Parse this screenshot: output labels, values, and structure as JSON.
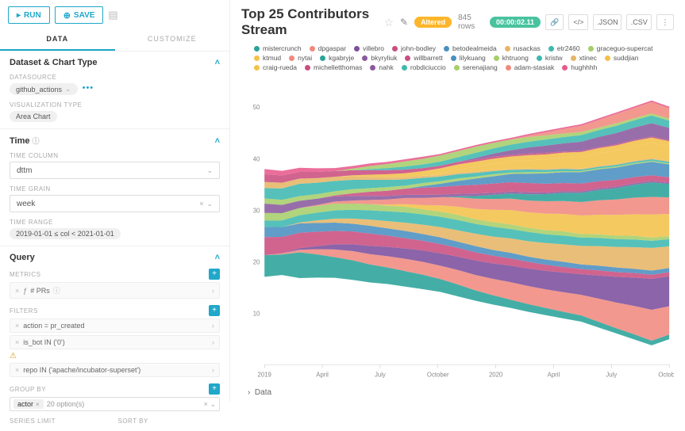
{
  "toolbar": {
    "run": "RUN",
    "save": "SAVE"
  },
  "tabs": {
    "data": "DATA",
    "customize": "CUSTOMIZE"
  },
  "panels": {
    "dataset": {
      "title": "Dataset & Chart Type",
      "datasource_label": "DATASOURCE",
      "datasource_value": "github_actions",
      "viz_label": "VISUALIZATION TYPE",
      "viz_value": "Area Chart"
    },
    "time": {
      "title": "Time",
      "col_label": "TIME COLUMN",
      "col_value": "dttm",
      "grain_label": "TIME GRAIN",
      "grain_value": "week",
      "range_label": "TIME RANGE",
      "range_value": "2019-01-01 ≤ col < 2021-01-01"
    },
    "query": {
      "title": "Query",
      "metrics_label": "METRICS",
      "metric_value": "# PRs",
      "filters_label": "FILTERS",
      "filters": [
        "action = pr_created",
        "is_bot IN ('0')",
        "repo IN ('apache/incubator-superset')"
      ],
      "groupby_label": "GROUP BY",
      "groupby_value": "actor",
      "groupby_options": "20 option(s)",
      "series_label": "SERIES LIMIT",
      "sort_label": "SORT BY"
    }
  },
  "header": {
    "title": "Top 25 Contributors Stream",
    "badge": "Altered",
    "rows": "845 rows",
    "timing": "00:00:02.11",
    "json": ".JSON",
    "csv": ".CSV"
  },
  "data_section": "Data",
  "chart_data": {
    "type": "area",
    "xlabel": "",
    "ylabel": "",
    "ylim": [
      0,
      55
    ],
    "x_ticks": [
      "2019",
      "April",
      "July",
      "October",
      "2020",
      "April",
      "July",
      "October"
    ],
    "y_ticks": [
      10,
      20,
      30,
      40,
      50
    ],
    "series": [
      {
        "name": "mistercrunch",
        "color": "#2aa39a",
        "values": [
          4.2,
          4.0,
          5.0,
          4.5,
          4.0,
          3.8,
          3.5,
          3.2,
          3.0,
          2.8,
          2.5,
          2.3,
          2.0,
          1.8,
          1.6,
          1.5,
          1.4,
          1.3,
          1.2,
          1.1,
          1.0,
          1.0,
          0.9,
          0.9
        ]
      },
      {
        "name": "dpgaspar",
        "color": "#f08a7e",
        "values": [
          0.0,
          0.2,
          0.5,
          1.0,
          1.5,
          1.8,
          2.0,
          2.2,
          2.4,
          2.5,
          2.6,
          2.8,
          3.0,
          3.2,
          3.4,
          3.5,
          3.6,
          3.8,
          4.0,
          4.5,
          5.0,
          5.5,
          6.0,
          5.5
        ]
      },
      {
        "name": "villebro",
        "color": "#7b4f9d",
        "values": [
          0.0,
          0.0,
          0.3,
          0.6,
          1.0,
          1.3,
          1.6,
          1.8,
          2.0,
          2.2,
          2.4,
          2.6,
          2.8,
          3.0,
          3.2,
          3.4,
          3.6,
          3.8,
          4.0,
          4.5,
          5.0,
          5.5,
          6.0,
          5.8
        ]
      },
      {
        "name": "john-bodley",
        "color": "#c94f80",
        "values": [
          3.5,
          3.2,
          3.0,
          2.8,
          2.6,
          2.5,
          2.4,
          2.2,
          2.0,
          1.9,
          1.8,
          1.7,
          1.6,
          1.5,
          1.4,
          1.3,
          1.2,
          1.1,
          1.0,
          1.0,
          0.9,
          0.9,
          0.8,
          0.8
        ]
      },
      {
        "name": "betodealmeida",
        "color": "#4a90c0",
        "values": [
          2.0,
          1.9,
          1.8,
          1.7,
          1.6,
          1.5,
          1.5,
          1.4,
          1.4,
          1.3,
          1.3,
          1.2,
          1.2,
          1.1,
          1.1,
          1.0,
          1.0,
          1.0,
          0.9,
          0.9,
          0.9,
          0.8,
          0.8,
          0.8
        ]
      },
      {
        "name": "rusackas",
        "color": "#e6b566",
        "values": [
          0.0,
          0.0,
          0.2,
          0.5,
          0.8,
          1.0,
          1.2,
          1.4,
          1.6,
          1.8,
          2.0,
          2.2,
          2.4,
          2.6,
          2.8,
          3.0,
          3.2,
          3.4,
          3.6,
          3.8,
          4.0,
          4.2,
          4.4,
          4.2
        ]
      },
      {
        "name": "etr2460",
        "color": "#3eb8b0",
        "values": [
          1.2,
          1.3,
          1.4,
          1.5,
          1.6,
          1.7,
          1.8,
          1.9,
          2.0,
          2.0,
          2.0,
          2.0,
          1.9,
          1.9,
          1.8,
          1.8,
          1.7,
          1.7,
          1.6,
          1.6,
          1.5,
          1.5,
          1.4,
          1.4
        ]
      },
      {
        "name": "graceguo-supercat",
        "color": "#a6ce6a",
        "values": [
          1.5,
          1.4,
          1.4,
          1.3,
          1.3,
          1.2,
          1.2,
          1.1,
          1.1,
          1.0,
          1.0,
          1.0,
          0.9,
          0.9,
          0.9,
          0.8,
          0.8,
          0.8,
          0.7,
          0.7,
          0.7,
          0.7,
          0.6,
          0.6
        ]
      },
      {
        "name": "ktmud",
        "color": "#f3c14a",
        "values": [
          0.0,
          0.0,
          0.0,
          0.0,
          0.0,
          0.0,
          0.0,
          0.2,
          0.5,
          0.8,
          1.2,
          1.6,
          2.0,
          2.4,
          2.8,
          3.0,
          3.2,
          3.4,
          3.6,
          3.8,
          4.0,
          4.2,
          4.5,
          4.3
        ]
      },
      {
        "name": "nytai",
        "color": "#f08a7e",
        "values": [
          0.0,
          0.0,
          0.0,
          0.2,
          0.4,
          0.6,
          0.8,
          1.0,
          1.2,
          1.4,
          1.6,
          1.8,
          2.0,
          2.1,
          2.2,
          2.3,
          2.4,
          2.5,
          2.6,
          2.8,
          3.0,
          3.2,
          3.4,
          3.2
        ]
      },
      {
        "name": "kgabryje",
        "color": "#2aa39a",
        "values": [
          0.0,
          0.0,
          0.0,
          0.0,
          0.0,
          0.0,
          0.0,
          0.0,
          0.0,
          0.0,
          0.0,
          0.2,
          0.5,
          0.8,
          1.0,
          1.2,
          1.4,
          1.6,
          1.8,
          2.0,
          2.2,
          2.5,
          2.8,
          2.6
        ]
      },
      {
        "name": "bkyryliuk",
        "color": "#8a5a9e",
        "values": [
          1.8,
          1.6,
          1.4,
          1.2,
          1.0,
          0.9,
          0.8,
          0.7,
          0.6,
          0.6,
          0.5,
          0.5,
          0.5,
          0.4,
          0.4,
          0.4,
          0.3,
          0.3,
          0.3,
          0.3,
          0.3,
          0.3,
          0.3,
          0.3
        ]
      },
      {
        "name": "willbarrett",
        "color": "#c94f80",
        "values": [
          0.0,
          0.0,
          0.0,
          0.0,
          0.2,
          0.5,
          0.8,
          1.0,
          1.2,
          1.4,
          1.5,
          1.6,
          1.7,
          1.8,
          1.8,
          1.8,
          1.7,
          1.6,
          1.5,
          1.4,
          1.3,
          1.2,
          1.1,
          1.0
        ]
      },
      {
        "name": "lilykuang",
        "color": "#4a90c0",
        "values": [
          0.0,
          0.0,
          0.0,
          0.0,
          0.0,
          0.0,
          0.0,
          0.0,
          0.0,
          0.3,
          0.6,
          0.9,
          1.2,
          1.4,
          1.6,
          1.8,
          2.0,
          2.1,
          2.2,
          2.3,
          2.4,
          2.5,
          2.6,
          2.5
        ]
      },
      {
        "name": "khtruong",
        "color": "#a6ce6a",
        "values": [
          1.0,
          1.0,
          0.9,
          0.9,
          0.8,
          0.8,
          0.7,
          0.7,
          0.6,
          0.6,
          0.5,
          0.5,
          0.4,
          0.4,
          0.3,
          0.3,
          0.3,
          0.2,
          0.2,
          0.2,
          0.2,
          0.2,
          0.2,
          0.2
        ]
      },
      {
        "name": "kristw",
        "color": "#3eb8b0",
        "values": [
          2.0,
          2.2,
          2.4,
          2.2,
          2.0,
          1.8,
          1.6,
          1.4,
          1.2,
          1.0,
          0.9,
          0.8,
          0.7,
          0.6,
          0.5,
          0.5,
          0.4,
          0.4,
          0.3,
          0.3,
          0.3,
          0.3,
          0.3,
          0.3
        ]
      },
      {
        "name": "xtinec",
        "color": "#e6b566",
        "values": [
          1.2,
          1.1,
          1.0,
          0.9,
          0.8,
          0.7,
          0.6,
          0.5,
          0.4,
          0.4,
          0.3,
          0.3,
          0.3,
          0.2,
          0.2,
          0.2,
          0.2,
          0.2,
          0.2,
          0.2,
          0.2,
          0.2,
          0.2,
          0.2
        ]
      },
      {
        "name": "suddjian",
        "color": "#f3c14a",
        "values": [
          0.0,
          0.0,
          0.0,
          0.0,
          0.0,
          0.0,
          0.0,
          0.0,
          0.0,
          0.0,
          0.3,
          0.6,
          0.9,
          1.2,
          1.4,
          1.6,
          1.8,
          2.0,
          2.2,
          2.4,
          2.6,
          2.8,
          3.0,
          2.8
        ]
      },
      {
        "name": "craig-rueda",
        "color": "#f3c14a",
        "values": [
          0.0,
          0.0,
          0.0,
          0.0,
          0.0,
          0.2,
          0.4,
          0.6,
          0.8,
          0.9,
          1.0,
          1.0,
          1.0,
          1.0,
          1.0,
          1.0,
          1.0,
          1.0,
          1.0,
          1.0,
          1.0,
          1.0,
          1.0,
          1.0
        ]
      },
      {
        "name": "michelletthomas",
        "color": "#c94f80",
        "values": [
          1.5,
          1.4,
          1.3,
          1.2,
          1.1,
          1.0,
          0.9,
          0.8,
          0.7,
          0.6,
          0.5,
          0.5,
          0.4,
          0.4,
          0.3,
          0.3,
          0.3,
          0.2,
          0.2,
          0.2,
          0.2,
          0.2,
          0.2,
          0.2
        ]
      },
      {
        "name": "nahk",
        "color": "#8a5a9e",
        "values": [
          0.0,
          0.0,
          0.0,
          0.0,
          0.0,
          0.0,
          0.0,
          0.0,
          0.0,
          0.0,
          0.0,
          0.0,
          0.3,
          0.6,
          0.9,
          1.2,
          1.4,
          1.6,
          1.8,
          2.0,
          2.2,
          2.4,
          2.6,
          2.4
        ]
      },
      {
        "name": "robdiciuccio",
        "color": "#3eb8b0",
        "values": [
          0.0,
          0.0,
          0.0,
          0.0,
          0.0,
          0.0,
          0.2,
          0.4,
          0.6,
          0.7,
          0.8,
          0.9,
          1.0,
          1.0,
          1.1,
          1.1,
          1.2,
          1.2,
          1.3,
          1.3,
          1.4,
          1.4,
          1.5,
          1.4
        ]
      },
      {
        "name": "serenajiang",
        "color": "#a6ce6a",
        "values": [
          0.0,
          0.0,
          0.0,
          0.0,
          0.0,
          0.3,
          0.6,
          0.8,
          1.0,
          1.1,
          1.2,
          1.2,
          1.2,
          1.1,
          1.0,
          0.9,
          0.8,
          0.7,
          0.6,
          0.5,
          0.5,
          0.4,
          0.4,
          0.4
        ]
      },
      {
        "name": "adam-stasiak",
        "color": "#f08a7e",
        "values": [
          0.0,
          0.0,
          0.0,
          0.0,
          0.0,
          0.0,
          0.0,
          0.0,
          0.0,
          0.0,
          0.0,
          0.0,
          0.0,
          0.0,
          0.0,
          0.3,
          0.6,
          0.9,
          1.2,
          1.5,
          1.8,
          2.0,
          2.2,
          2.0
        ]
      },
      {
        "name": "hughhhh",
        "color": "#e85a8c",
        "values": [
          1.0,
          0.9,
          0.8,
          0.7,
          0.6,
          0.5,
          0.5,
          0.4,
          0.4,
          0.4,
          0.3,
          0.3,
          0.3,
          0.3,
          0.3,
          0.3,
          0.3,
          0.3,
          0.3,
          0.3,
          0.3,
          0.3,
          0.3,
          0.3
        ]
      }
    ]
  }
}
